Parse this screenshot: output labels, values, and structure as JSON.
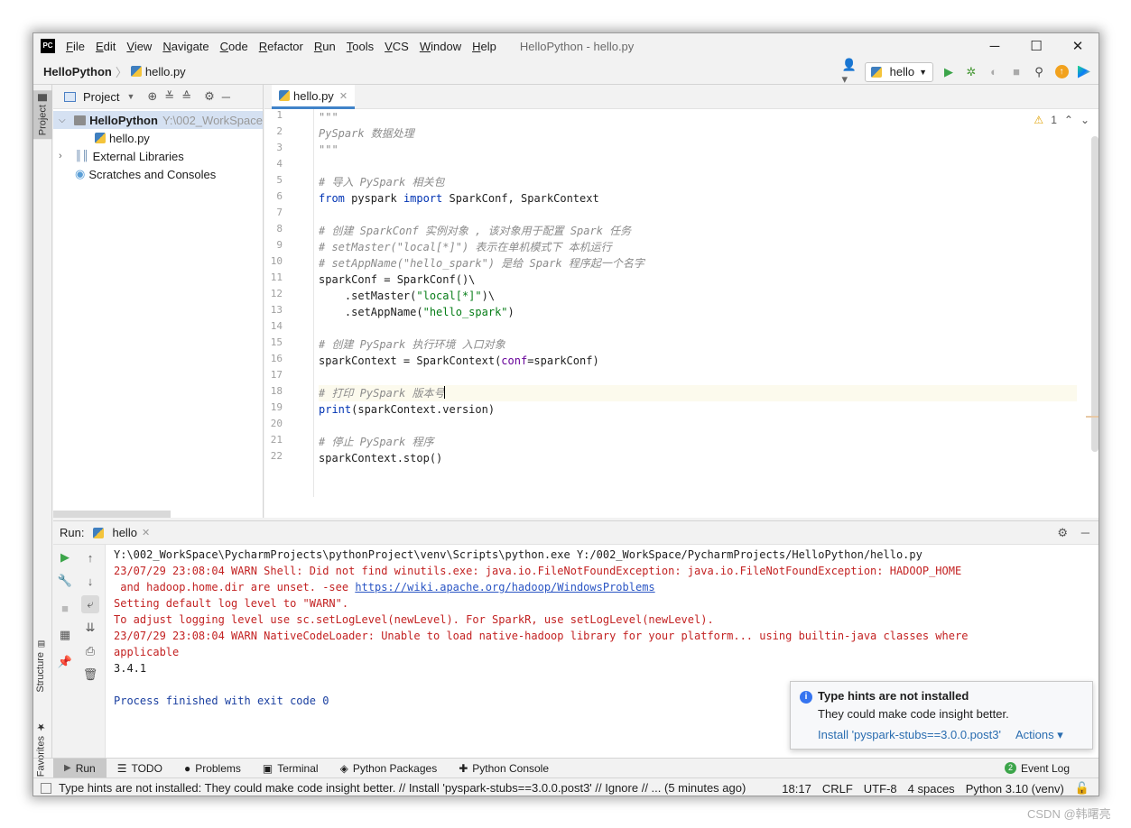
{
  "menubar": {
    "logo": "PC",
    "items": [
      "File",
      "Edit",
      "View",
      "Navigate",
      "Code",
      "Refactor",
      "Run",
      "Tools",
      "VCS",
      "Window",
      "Help"
    ],
    "title": "HelloPython - hello.py",
    "minimize": "─",
    "maximize": "☐",
    "close": "✕"
  },
  "navbar": {
    "project": "HelloPython",
    "file": "hello.py",
    "run_config": "hello"
  },
  "left_strip": {
    "project": "Project",
    "structure": "Structure",
    "favorites": "Favorites"
  },
  "project_panel": {
    "title": "Project",
    "root_name": "HelloPython",
    "root_path": "Y:\\002_WorkSpace",
    "file": "hello.py",
    "external_libs": "External Libraries",
    "scratches": "Scratches and Consoles"
  },
  "editor": {
    "tab": "hello.py",
    "warnings": "1",
    "line_numbers": [
      "1",
      "2",
      "3",
      "4",
      "5",
      "6",
      "7",
      "8",
      "9",
      "10",
      "11",
      "12",
      "13",
      "14",
      "15",
      "16",
      "17",
      "18",
      "19",
      "20",
      "21",
      "22"
    ]
  },
  "code": {
    "l1": "\"\"\"",
    "l2": "PySpark 数据处理",
    "l3": "\"\"\"",
    "l5": "# 导入 PySpark 相关包",
    "l6_kw1": "from",
    "l6_mod": " pyspark ",
    "l6_kw2": "import",
    "l6_rest": " SparkConf, SparkContext",
    "l8": "# 创建 SparkConf 实例对象 , 该对象用于配置 Spark 任务",
    "l9": "# setMaster(\"local[*]\") 表示在单机模式下 本机运行",
    "l10": "# setAppName(\"hello_spark\") 是给 Spark 程序起一个名字",
    "l11": "sparkConf = SparkConf()\\",
    "l12_a": "    .setMaster(",
    "l12_s": "\"local[*]\"",
    "l12_b": ")\\",
    "l13_a": "    .setAppName(",
    "l13_s": "\"hello_spark\"",
    "l13_b": ")",
    "l15": "# 创建 PySpark 执行环境 入口对象",
    "l16_a": "sparkContext = SparkContext(",
    "l16_p": "conf",
    "l16_b": "=sparkConf)",
    "l18": "# 打印 PySpark 版本号",
    "l19_kw": "print",
    "l19_rest": "(sparkContext.version)",
    "l21": "# 停止 PySpark 程序",
    "l22": "sparkContext.stop()"
  },
  "run": {
    "label": "Run:",
    "tab": "hello",
    "out1": "Y:\\002_WorkSpace\\PycharmProjects\\pythonProject\\venv\\Scripts\\python.exe Y:/002_WorkSpace/PycharmProjects/HelloPython/hello.py",
    "out2": "23/07/29 23:08:04 WARN Shell: Did not find winutils.exe: java.io.FileNotFoundException: java.io.FileNotFoundException: HADOOP_HOME",
    "out3_a": " and hadoop.home.dir are unset. -see ",
    "out3_link": "https://wiki.apache.org/hadoop/WindowsProblems",
    "out4": "Setting default log level to \"WARN\".",
    "out5": "To adjust logging level use sc.setLogLevel(newLevel). For SparkR, use setLogLevel(newLevel).",
    "out6": "23/07/29 23:08:04 WARN NativeCodeLoader: Unable to load native-hadoop library for your platform... using builtin-java classes where",
    "out7": "applicable",
    "out8": "3.4.1",
    "out9": "Process finished with exit code 0"
  },
  "popup": {
    "title": "Type hints are not installed",
    "body": "They could make code insight better.",
    "install": "Install 'pyspark-stubs==3.0.0.post3'",
    "actions": "Actions ▾"
  },
  "bottom_tabs": [
    "Run",
    "TODO",
    "Problems",
    "Terminal",
    "Python Packages",
    "Python Console"
  ],
  "event_log": {
    "count": "2",
    "label": "Event Log"
  },
  "status": {
    "message": "Type hints are not installed: They could make code insight better. // Install 'pyspark-stubs==3.0.0.post3' // Ignore // ... (5 minutes ago)",
    "position": "18:17",
    "line_sep": "CRLF",
    "encoding": "UTF-8",
    "indent": "4 spaces",
    "interpreter": "Python 3.10 (venv)"
  },
  "watermark": "CSDN @韩曙亮",
  "colors": {
    "accent": "#4083c9",
    "run_green": "#3ca54a",
    "error_red": "#c32222",
    "comment": "#8c8c8c"
  }
}
